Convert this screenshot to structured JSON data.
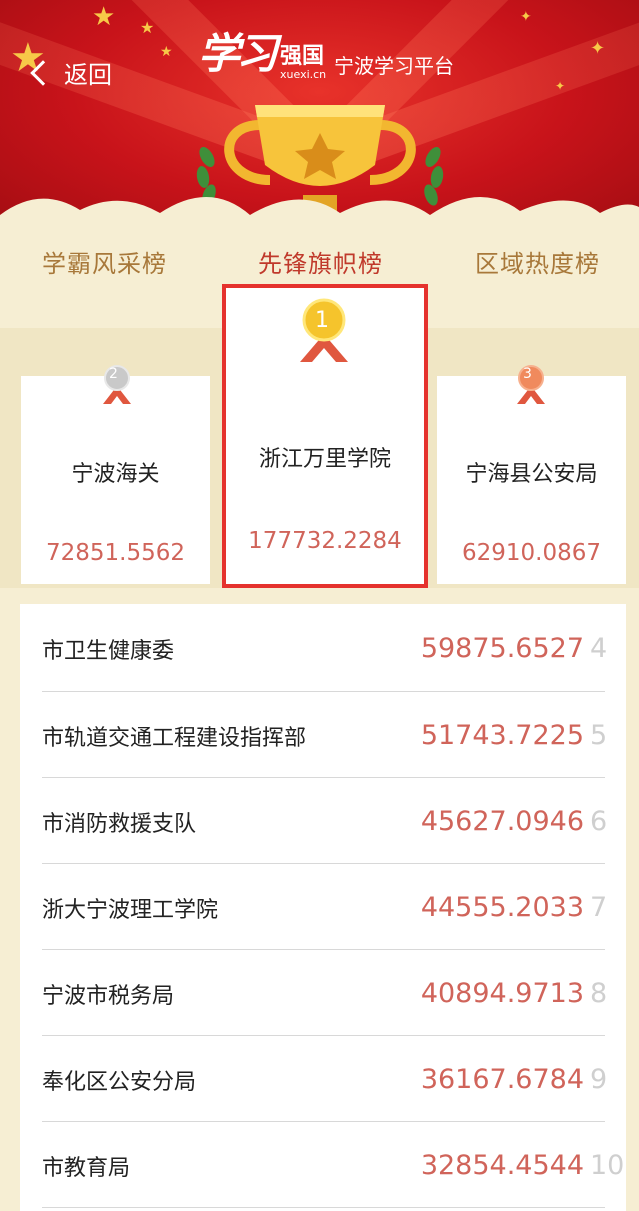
{
  "header": {
    "back_label": "返回",
    "logo_main": "学习",
    "logo_strong": "强国",
    "logo_url": "xuexi.cn",
    "platform": "宁波学习平台"
  },
  "tabs": [
    {
      "label": "学霸风采榜",
      "active": false
    },
    {
      "label": "先锋旗帜榜",
      "active": true
    },
    {
      "label": "区域热度榜",
      "active": false
    }
  ],
  "podium": {
    "first": {
      "rank": "1",
      "name": "浙江万里学院",
      "score": "177732.2284"
    },
    "second": {
      "rank": "2",
      "name": "宁波海关",
      "score": "72851.5562"
    },
    "third": {
      "rank": "3",
      "name": "宁海县公安局",
      "score": "62910.0867"
    }
  },
  "list": [
    {
      "name": "市卫生健康委",
      "score": "59875.6527",
      "rank": "4"
    },
    {
      "name": "市轨道交通工程建设指挥部",
      "score": "51743.7225",
      "rank": "5"
    },
    {
      "name": "市消防救援支队",
      "score": "45627.0946",
      "rank": "6"
    },
    {
      "name": "浙大宁波理工学院",
      "score": "44555.2033",
      "rank": "7"
    },
    {
      "name": "宁波市税务局",
      "score": "40894.9713",
      "rank": "8"
    },
    {
      "name": "奉化区公安分局",
      "score": "36167.6784",
      "rank": "9"
    },
    {
      "name": "市教育局",
      "score": "32854.4544",
      "rank": "10"
    }
  ],
  "colors": {
    "banner_red": "#c8131a",
    "gold": "#f7c948",
    "tab_inactive": "#a8783a",
    "score_red": "#d0645a",
    "highlight_red": "#e5322d",
    "background": "#f6eed3"
  },
  "icons": {
    "back": "chevron-left-icon",
    "trophy": "trophy-icon",
    "medal_gold": "medal-gold-icon",
    "medal_silver": "medal-silver-icon",
    "medal_bronze": "medal-bronze-icon"
  }
}
